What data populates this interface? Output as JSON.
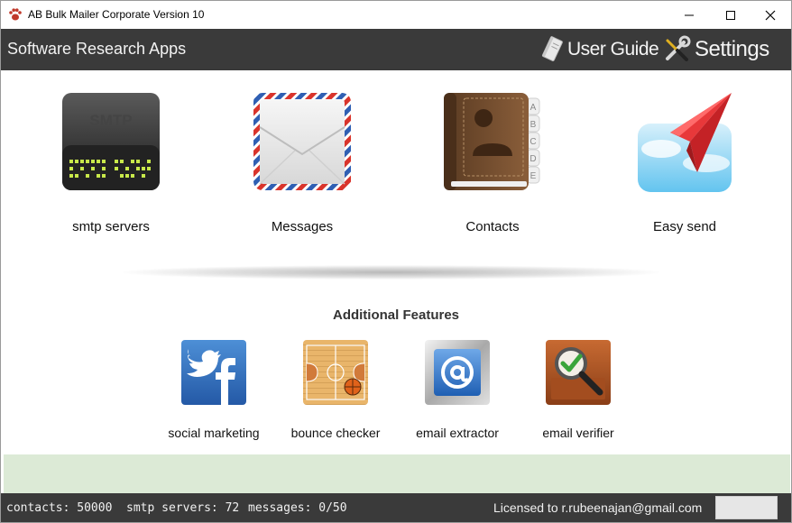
{
  "window": {
    "title": "AB Bulk Mailer Corporate Version 10",
    "controls": [
      "minimize",
      "maximize",
      "close"
    ]
  },
  "header": {
    "brand": "Software Research Apps",
    "user_guide_label": "User Guide",
    "settings_label": "Settings"
  },
  "tiles": [
    {
      "label": "smtp servers",
      "icon": "smtp-server-icon",
      "icon_text": "SMTP"
    },
    {
      "label": "Messages",
      "icon": "airmail-envelope-icon"
    },
    {
      "label": "Contacts",
      "icon": "address-book-icon",
      "tabs": [
        "A",
        "B",
        "C",
        "D",
        "E"
      ]
    },
    {
      "label": "Easy send",
      "icon": "paper-plane-icon"
    }
  ],
  "additional": {
    "title": "Additional Features",
    "items": [
      {
        "label": "social marketing",
        "icon": "twitter-facebook-icon"
      },
      {
        "label": "bounce checker",
        "icon": "basketball-court-icon"
      },
      {
        "label": "email extractor",
        "icon": "at-sign-icon"
      },
      {
        "label": "email verifier",
        "icon": "magnifier-check-icon"
      }
    ]
  },
  "status": {
    "contacts": "contacts: 50000",
    "smtp_servers": "smtp servers: 72",
    "messages": "messages: 0/50",
    "license": "Licensed to r.rubeenajan@gmail.com"
  },
  "colors": {
    "header_bg": "#3a3a3a",
    "band_green": "#dcead6",
    "airmail_red": "#d9342b",
    "airmail_blue": "#2f5fb3",
    "plane_red": "#e8383a",
    "sky_blue": "#8fd3f4"
  }
}
